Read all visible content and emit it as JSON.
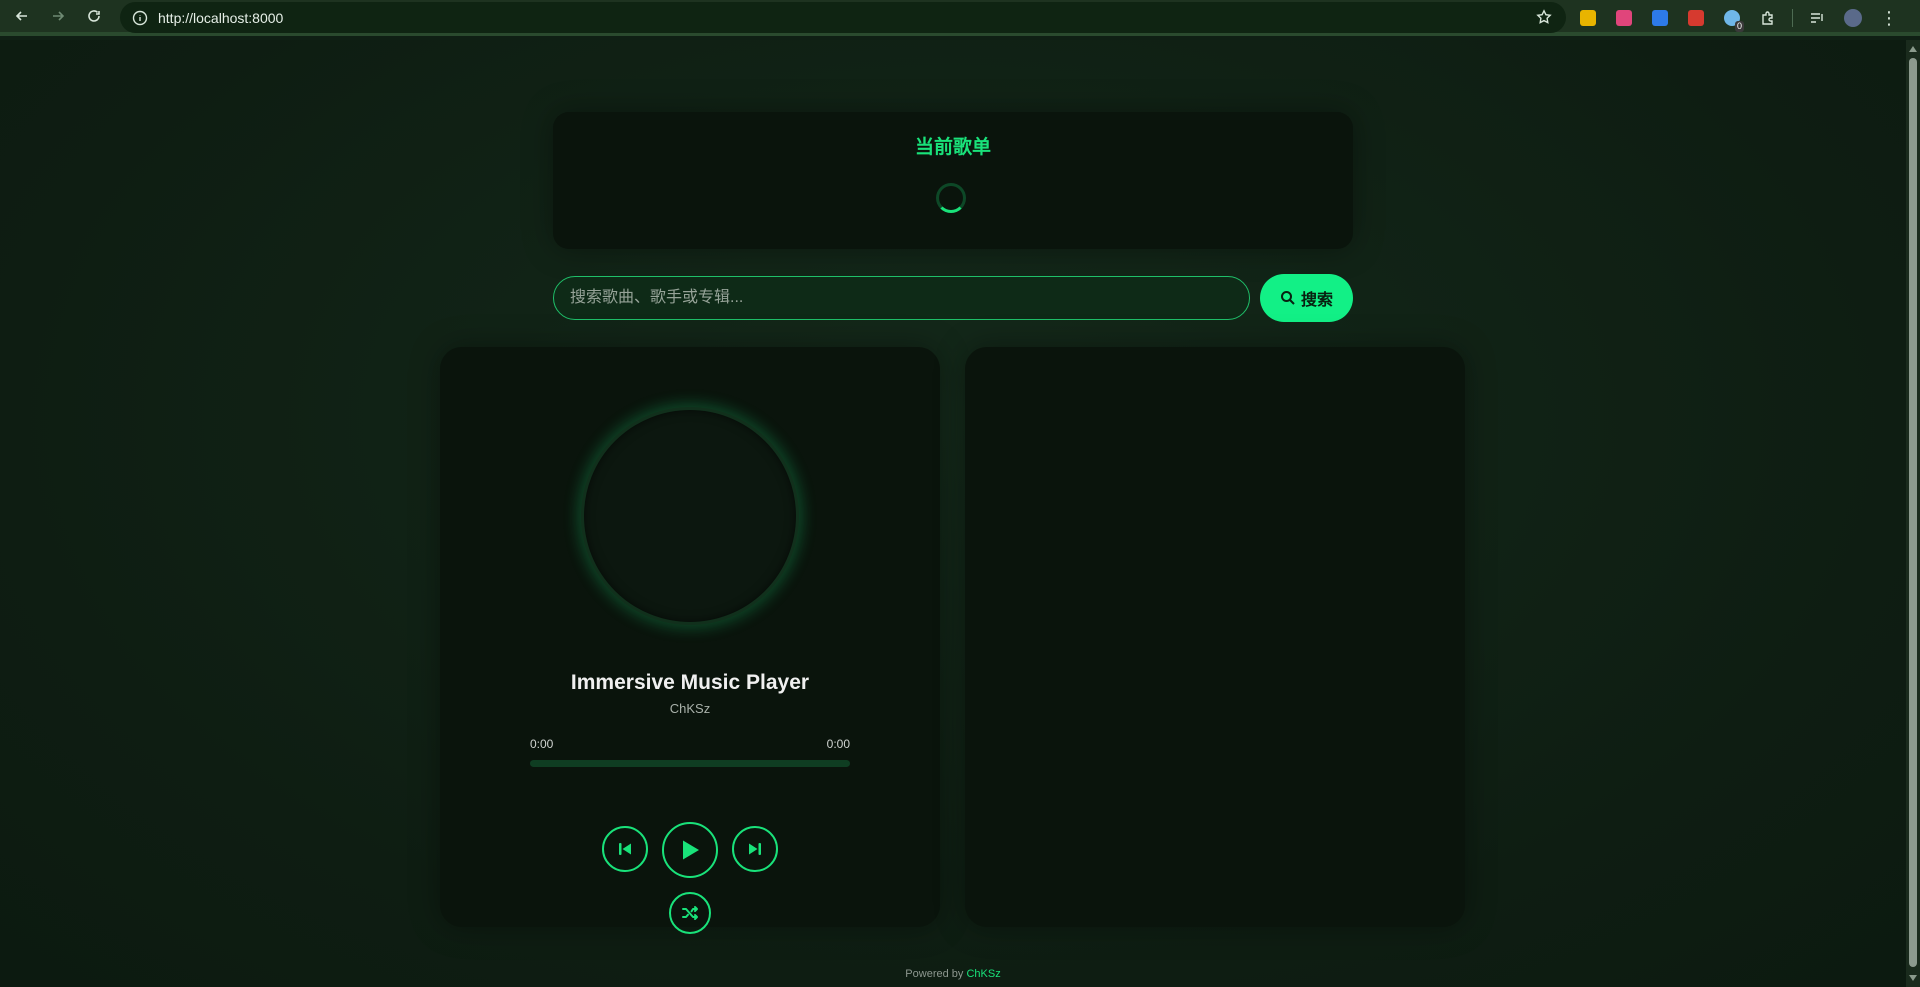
{
  "browser": {
    "url": "http://localhost:8000",
    "extension_badge": "0"
  },
  "playlist": {
    "title": "当前歌单"
  },
  "search": {
    "placeholder": "搜索歌曲、歌手或专辑...",
    "value": "",
    "button_label": "搜索"
  },
  "player": {
    "title": "Immersive Music Player",
    "artist": "ChKSz",
    "current_time": "0:00",
    "total_time": "0:00",
    "progress": 0
  },
  "footer": {
    "prefix": "Powered by ",
    "brand": "ChKSz"
  },
  "colors": {
    "accent": "#19e27a",
    "button": "#12f086",
    "card": "#0a140c",
    "background": "#0f1f14"
  }
}
